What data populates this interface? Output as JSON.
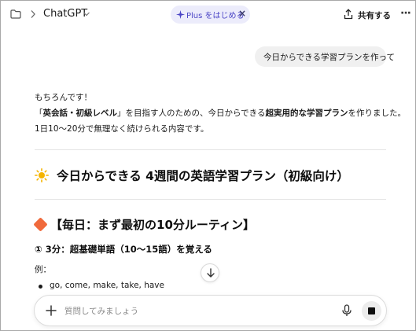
{
  "header": {
    "app_title": "ChatGPT",
    "plus_label": "Plus をはじめる",
    "plus_close": "×",
    "share_label": "共有する",
    "more_label": "···"
  },
  "user_message": "今日からできる学習プランを作って",
  "assistant": {
    "greeting": "もちろんです！",
    "intro_parts": [
      "「",
      "英会話・初級レベル",
      "」を目指す人のための、今日からできる",
      "超実用的な学習プラン",
      "を作りました。"
    ],
    "intro2": "1日10〜20分で無理なく続けられる内容です。",
    "plan_title": "今日からできる 4週間の英語学習プラン（初級向け）",
    "daily_heading": "【毎日：まず最初の10分ルーティン】",
    "step1": "① 3分：超基礎単語（10〜15語）を覚える",
    "example_label": "例：",
    "example_items": [
      "go, come, make, take, have"
    ]
  },
  "composer": {
    "placeholder": "質問してみましょう"
  },
  "icons": {
    "folder": "folder-icon",
    "chevron": "chevron-right-icon",
    "share": "share-icon",
    "sun": "sun-icon",
    "diamond": "orange-diamond-icon",
    "mic": "mic-icon",
    "stop": "stop-icon"
  },
  "colors": {
    "plus_pill_bg": "#ececfb",
    "plus_accent": "#4b45c6",
    "diamond": "#f06a3c",
    "sun": "#f5b400"
  }
}
